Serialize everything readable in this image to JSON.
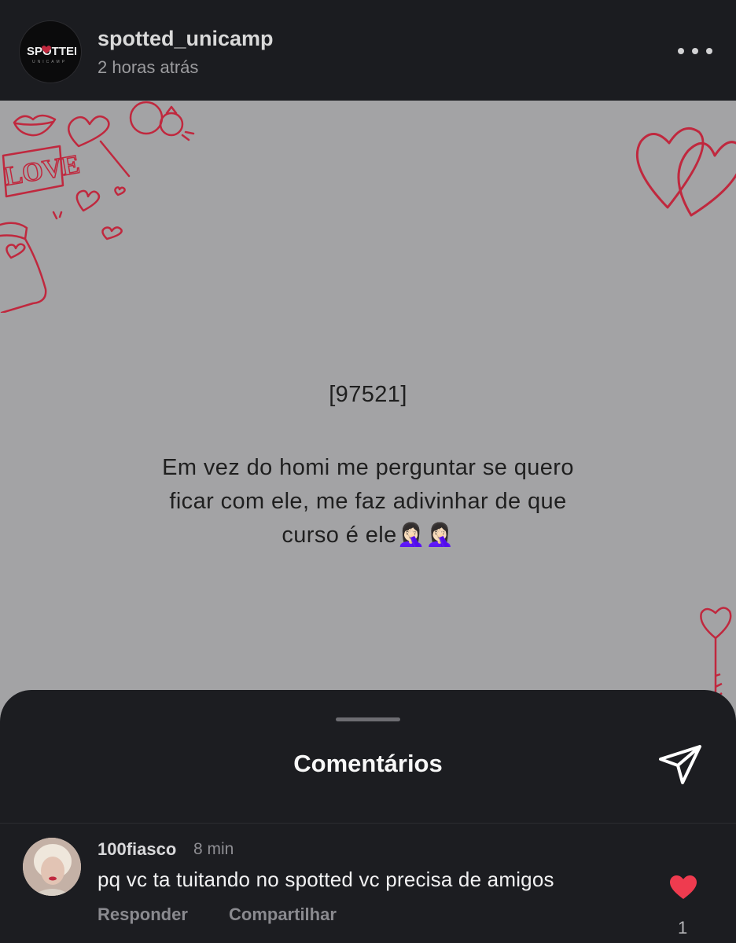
{
  "header": {
    "avatar_brand": "SPOTTED",
    "avatar_sub": "UNICAMP",
    "username": "spotted_unicamp",
    "timestamp": "2 horas atrás"
  },
  "post": {
    "deco_word": "LOVE",
    "id_label": "[97521]",
    "lines": [
      "Em vez do homi me perguntar se quero",
      "ficar com ele, me faz adivinhar de que",
      "curso é ele🤦🏻‍♀️🤦🏻‍♀️"
    ]
  },
  "comments_sheet": {
    "title": "Comentários",
    "comments": [
      {
        "username": "100fiasco",
        "time": "8 min",
        "text": "pq vc ta tuitando no spotted vc precisa de amigos",
        "reply_label": "Responder",
        "share_label": "Compartilhar",
        "likes": "1"
      }
    ]
  },
  "colors": {
    "post_bg": "#a3a3a5",
    "doodle_red": "#c0283e",
    "like_red": "#ef3b4f",
    "sheet_bg": "#1c1d21"
  },
  "icons": [
    "more-icon",
    "send-icon",
    "heart-icon"
  ]
}
